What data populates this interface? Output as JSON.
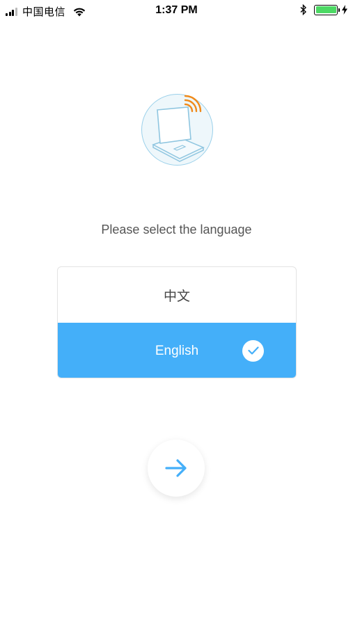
{
  "status_bar": {
    "carrier": "中国电信",
    "time": "1:37 PM"
  },
  "prompt": "Please select the language",
  "languages": [
    {
      "label": "中文",
      "selected": false
    },
    {
      "label": "English",
      "selected": true
    }
  ],
  "icons": {
    "device": "router-device-icon",
    "check": "check-icon",
    "next": "arrow-right-icon"
  },
  "colors": {
    "accent": "#44aff9",
    "signal_orange": "#f08a1a",
    "battery_green": "#4cd964"
  }
}
